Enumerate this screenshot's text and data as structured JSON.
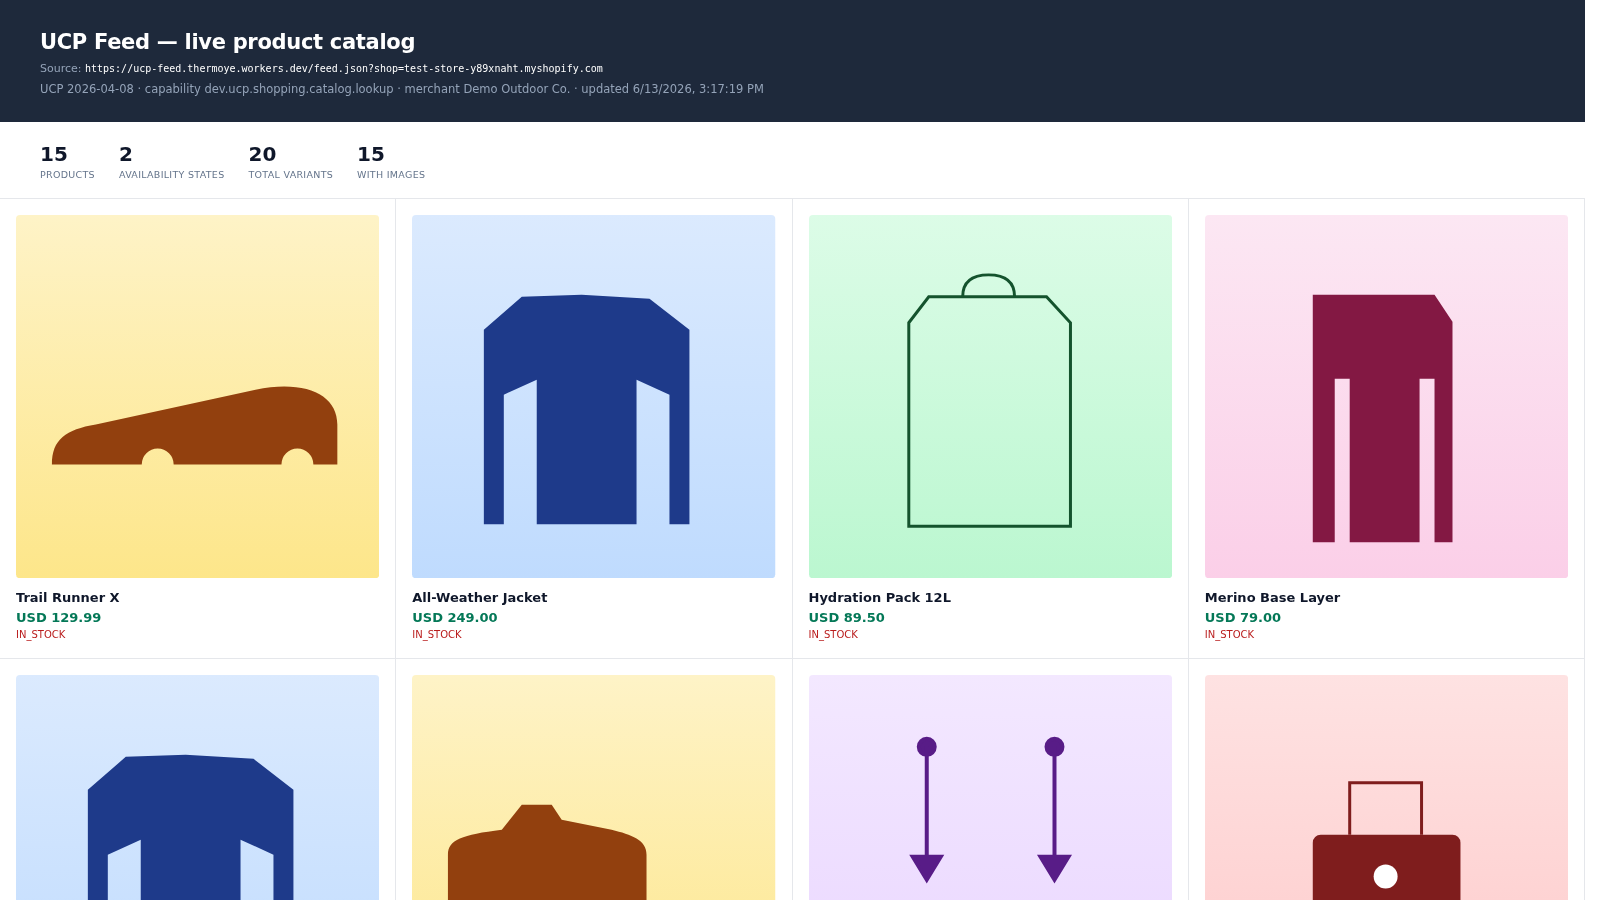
{
  "header": {
    "title": "UCP Feed — live product catalog",
    "source_label": "Source:",
    "source_url": "https://ucp-feed.thermoye.workers.dev/feed.json?shop=test-store-y89xnaht.myshopify.com",
    "meta": "UCP 2026-04-08 · capability dev.ucp.shopping.catalog.lookup · merchant Demo Outdoor Co. · updated 6/13/2026, 3:17:19 PM"
  },
  "stats": [
    {
      "value": "15",
      "label": "PRODUCTS"
    },
    {
      "value": "2",
      "label": "AVAILABILITY STATES"
    },
    {
      "value": "20",
      "label": "TOTAL VARIANTS"
    },
    {
      "value": "15",
      "label": "WITH IMAGES"
    }
  ],
  "products": [
    {
      "image": {
        "kind": "shoe"
      },
      "name": "Trail Runner X",
      "price": "USD 129.99",
      "availability": "IN_STOCK"
    },
    {
      "image": {
        "kind": "jacket"
      },
      "name": "All-Weather Jacket",
      "price": "USD 249.00",
      "availability": "IN_STOCK"
    },
    {
      "image": {
        "kind": "bag"
      },
      "name": "Hydration Pack 12L",
      "price": "USD 89.50",
      "availability": "IN_STOCK"
    },
    {
      "image": {
        "kind": "tights"
      },
      "name": "Merino Base Layer",
      "price": "USD 79.00",
      "availability": "IN_STOCK"
    },
    {
      "image": {
        "kind": "jacket"
      }
    },
    {
      "image": {
        "kind": "cap"
      }
    },
    {
      "image": {
        "kind": "poles"
      }
    },
    {
      "image": {
        "kind": "luggage"
      }
    }
  ]
}
